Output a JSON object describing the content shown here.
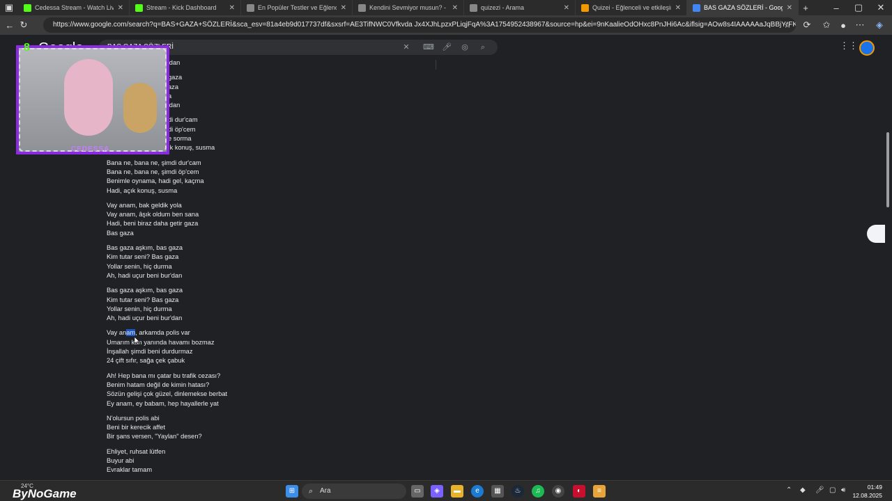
{
  "tabs": [
    {
      "label": "Cedessa Stream - Watch Live on K",
      "icon": "kick-icon",
      "color": "#53fc18"
    },
    {
      "label": "Stream - Kick Dashboard",
      "icon": "kick-icon",
      "color": "#53fc18"
    },
    {
      "label": "En Popüler Testler ve Eğlenceli Qu",
      "icon": "chat-icon",
      "color": "#888888"
    },
    {
      "label": "Kendini Sevmiyor musun? - Oneq",
      "icon": "chat-icon",
      "color": "#888888"
    },
    {
      "label": "quizezi - Arama",
      "icon": "search-icon",
      "color": "#888888"
    },
    {
      "label": "Quizei - Eğlenceli ve etkileşimli q",
      "icon": "quiz-icon",
      "color": "#f29900"
    },
    {
      "label": "BAS GAZA SÖZLERİ - Google'da a",
      "icon": "google-icon",
      "color": "#4285f4"
    }
  ],
  "url": "https://www.google.com/search?q=BAS+GAZA+SÖZLERİ&sca_esv=81a4eb9d017737df&sxsrf=AE3TifNWC0Vfkvda Jx4XJhLpzxPLiqjFqA%3A1754952438967&source=hp&ei=9nKaalieOdOHxc8PnJHi6Ac&iflsig=AOw8s4IAAAAAaJqBBjYrFKOuQlVMZ6BMp...",
  "google": {
    "logo": "Google",
    "query": "BAS GAZA SÖZLERİ"
  },
  "lyrics": {
    "partial": [
      [
        "'dan"
      ],
      [
        "gaza",
        "aza",
        "a",
        "'dan"
      ],
      [
        "di dur'cam",
        "di öp'cem",
        "e sorma",
        "ık konuş, susma"
      ]
    ],
    "stanzas": [
      [
        "Bana ne, bana ne, şimdi dur'cam",
        "Bana ne, bana ne, şimdi öp'cem",
        "Benimle oynama, hadi gel, kaçma",
        "Hadi, açık konuş, susma"
      ],
      [
        "Vay anam, bak geldik yola",
        "Vay anam, âşık oldum ben sana",
        "Hadi, beni biraz daha getir gaza",
        "Bas gaza"
      ],
      [
        "Bas gaza aşkım, bas gaza",
        "Kim tutar seni? Bas gaza",
        "Yollar senin, hiç durma",
        "Ah, hadi uçur beni bur'dan"
      ],
      [
        "Bas gaza aşkım, bas gaza",
        "Kim tutar seni? Bas gaza",
        "Yollar senin, hiç durma",
        "Ah, hadi uçur beni bur'dan"
      ],
      [
        "Vay anam, arkamda polis var",
        "Umarım kan yanında havamı bozmaz",
        "İnşallah şimdi beni durdurmaz",
        "24 çift sıfır, sağa çek çabuk"
      ],
      [
        "Ah! Hep bana mı çatar bu trafik cezası?",
        "Benim hatam değil de kimin hatası?",
        "Sözün gelişi çok güzel, dinlemekse berbat",
        "Ey anam, ey babam, hep hayallerle yat"
      ],
      [
        "N'olursun polis abi",
        "Beni bir kerecik affet",
        "Bir şans versen, \"Yaylan\" desen?"
      ],
      [
        "Ehliyet, ruhsat lütfen",
        "Buyur abi",
        "Evraklar tamam"
      ]
    ],
    "highlight_prefix": "Vay an",
    "highlight_text": "am"
  },
  "webcam": {
    "label": "CEDESSA",
    "badge": "8"
  },
  "taskbar": {
    "weather": "24°C",
    "brand": "ByNoGame",
    "search_placeholder": "Ara",
    "time": "01:49",
    "date": "12.08.2025"
  }
}
